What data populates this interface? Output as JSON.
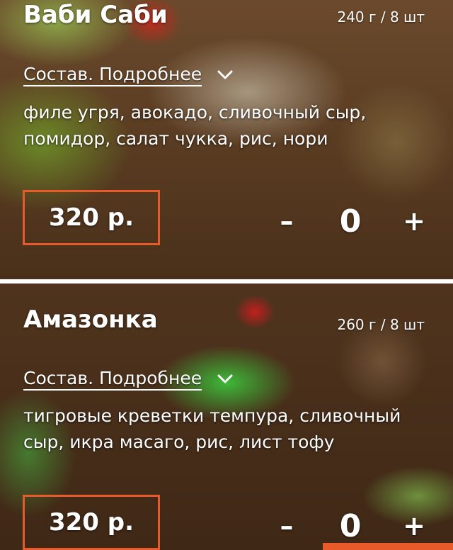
{
  "colors": {
    "accent": "#e85a2a",
    "text": "#ffffff"
  },
  "products": [
    {
      "title": "Ваби Саби",
      "weight": "240 г / 8 шт",
      "details_label": "Состав. Подробнее",
      "details_icon": "chevron-down-icon",
      "ingredients": "филе угря, авокадо, сливочный сыр, помидор, салат чукка, рис, нори",
      "price": "320 р.",
      "quantity": "0",
      "minus_label": "–",
      "plus_label": "+"
    },
    {
      "title": "Амазонка",
      "weight": "260 г / 8 шт",
      "details_label": "Состав. Подробнее",
      "details_icon": "chevron-down-icon",
      "ingredients": "тигровые креветки темпура, сливочный сыр, икра масаго, рис, лист тофу",
      "price": "320 р.",
      "quantity": "0",
      "minus_label": "–",
      "plus_label": "+"
    }
  ]
}
